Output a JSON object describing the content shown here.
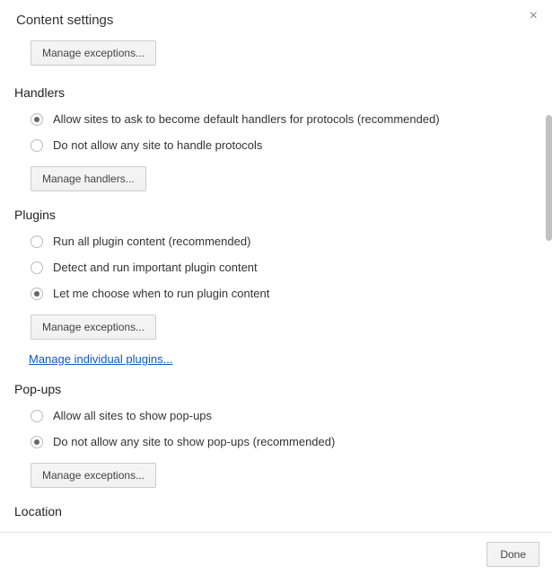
{
  "dialog": {
    "title": "Content settings",
    "close_glyph": "×",
    "done_label": "Done"
  },
  "top_button": {
    "label": "Manage exceptions..."
  },
  "handlers": {
    "title": "Handlers",
    "options": [
      {
        "label": "Allow sites to ask to become default handlers for protocols (recommended)",
        "checked": true
      },
      {
        "label": "Do not allow any site to handle protocols",
        "checked": false
      }
    ],
    "button": "Manage handlers..."
  },
  "plugins": {
    "title": "Plugins",
    "options": [
      {
        "label": "Run all plugin content (recommended)",
        "checked": false
      },
      {
        "label": "Detect and run important plugin content",
        "checked": false
      },
      {
        "label": "Let me choose when to run plugin content",
        "checked": true
      }
    ],
    "button": "Manage exceptions...",
    "link": "Manage individual plugins..."
  },
  "popups": {
    "title": "Pop-ups",
    "options": [
      {
        "label": "Allow all sites to show pop-ups",
        "checked": false
      },
      {
        "label": "Do not allow any site to show pop-ups (recommended)",
        "checked": true
      }
    ],
    "button": "Manage exceptions..."
  },
  "location": {
    "title": "Location"
  }
}
